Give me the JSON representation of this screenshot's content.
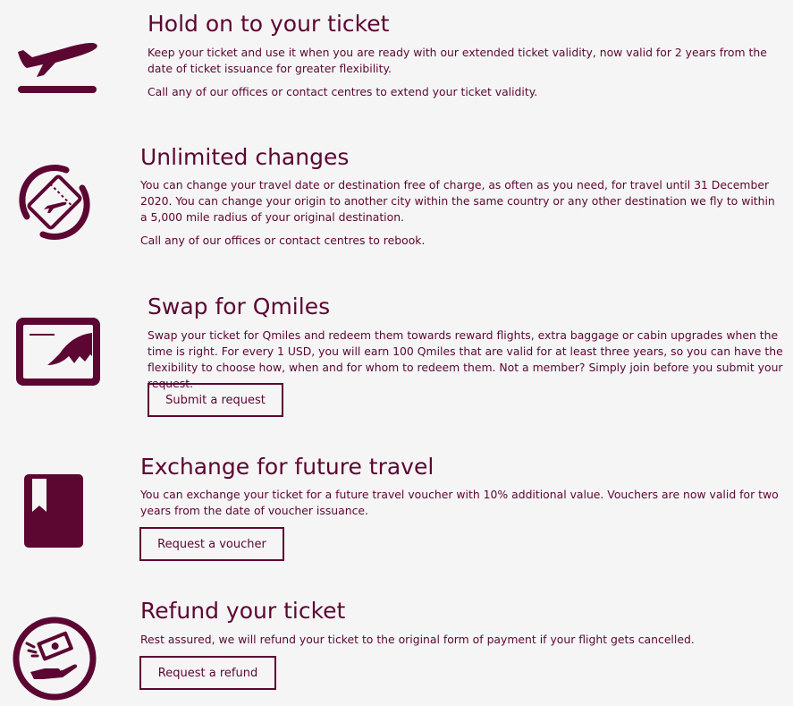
{
  "colors": {
    "brand": "#5c0632",
    "background": "#f5f5f5"
  },
  "sections": [
    {
      "icon": "airplane-takeoff-icon",
      "title": "Hold on to your ticket",
      "paragraphs": [
        "Keep your ticket and use it when you are ready with our extended ticket validity, now valid for 2 years from the date of ticket issuance for greater flexibility.",
        "Call any of our offices or contact centres to extend your ticket validity."
      ]
    },
    {
      "icon": "ticket-rotate-icon",
      "title": "Unlimited changes",
      "paragraphs": [
        "You can change your travel date or destination free of charge, as often as you need, for travel until 31 December 2020. You can change your origin to another city within the same country or any other destination we fly to within a 5,000 mile radius of your original destination.",
        "Call any of our offices or contact centres to rebook."
      ]
    },
    {
      "icon": "qmiles-card-icon",
      "title": "Swap for Qmiles",
      "paragraphs": [
        "Swap your ticket for Qmiles and redeem them towards reward flights, extra baggage or cabin upgrades when the time is right. For every 1 USD, you will earn 100 Qmiles that are valid for at least three years, so you can have the flexibility to choose how, when and for whom to redeem them. Not a member? Simply join before you submit your request."
      ],
      "button": "Submit a request"
    },
    {
      "icon": "voucher-book-icon",
      "title": "Exchange for future travel",
      "paragraphs": [
        "You can exchange your ticket for a future travel voucher with 10% additional value. Vouchers are now valid for two years from the date of voucher issuance."
      ],
      "button": "Request a voucher"
    },
    {
      "icon": "refund-money-icon",
      "title": "Refund your ticket",
      "paragraphs": [
        "Rest assured, we will refund your ticket to the original form of payment if your flight gets cancelled."
      ],
      "button": "Request a refund"
    }
  ]
}
